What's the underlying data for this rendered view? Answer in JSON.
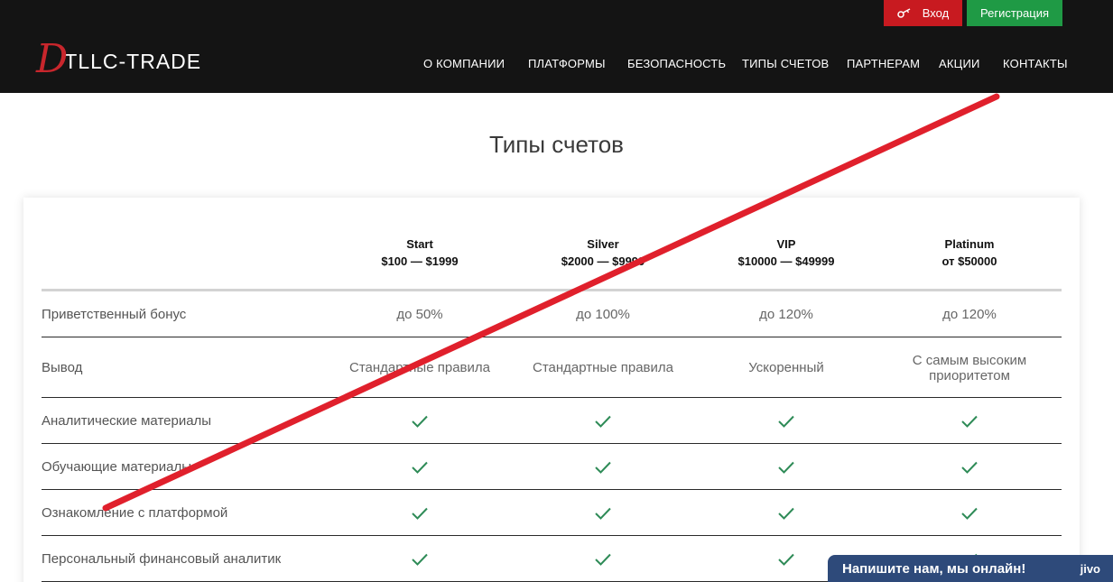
{
  "header": {
    "logo_mark": "D",
    "logo_text": "TLLC-TRADE",
    "login_label": "Вход",
    "register_label": "Регистрация",
    "nav": [
      {
        "label": "О КОМПАНИИ"
      },
      {
        "label": "ПЛАТФОРМЫ"
      },
      {
        "label": "БЕЗОПАСНОСТЬ"
      },
      {
        "label": "ТИПЫ СЧЕТОВ"
      },
      {
        "label": "ПАРТНЕРАМ"
      },
      {
        "label": "АКЦИИ"
      },
      {
        "label": "КОНТАКТЫ"
      }
    ]
  },
  "page_title": "Типы счетов",
  "plans": [
    {
      "name": "Start",
      "range": "$100 — $1999"
    },
    {
      "name": "Silver",
      "range": "$2000 — $9999"
    },
    {
      "name": "VIP",
      "range": "$10000 — $49999"
    },
    {
      "name": "Platinum",
      "range": "от $50000"
    }
  ],
  "rows": [
    {
      "label": "Приветственный бонус",
      "values": [
        "до 50%",
        "до 100%",
        "до 120%",
        "до 120%"
      ]
    },
    {
      "label": "Вывод",
      "values": [
        "Стандартные правила",
        "Стандартные правила",
        "Ускоренный",
        "С самым высоким приоритетом"
      ]
    },
    {
      "label": "Аналитические материалы",
      "values": [
        true,
        true,
        true,
        true
      ]
    },
    {
      "label": "Обучающие материалы",
      "values": [
        true,
        true,
        true,
        true
      ]
    },
    {
      "label": "Ознакомление с платформой",
      "values": [
        true,
        true,
        true,
        true
      ]
    },
    {
      "label": "Персональный финансовый аналитик",
      "values": [
        true,
        true,
        true,
        true
      ]
    }
  ],
  "chat": {
    "text": "Напишите нам, мы онлайн!",
    "brand": "jivo"
  },
  "colors": {
    "header_bg": "#141414",
    "login_bg": "#c81a20",
    "register_bg": "#1f9a45",
    "check": "#2e8b57",
    "cross_line": "#e0202c",
    "chat_bg": "#2e4a7a"
  },
  "icons": {
    "login": "key-icon",
    "check": "checkmark-icon"
  }
}
